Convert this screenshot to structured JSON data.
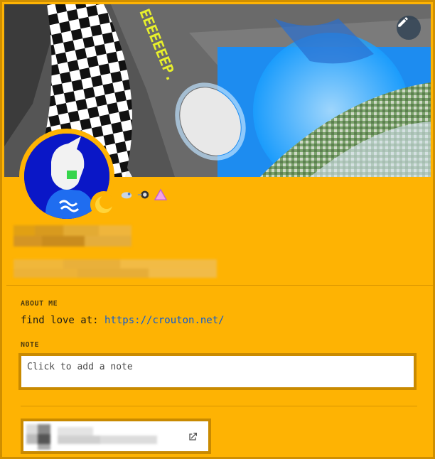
{
  "banner": {
    "graffiti_text": "EEEEEEEP.",
    "edit_button_icon": "pencil-icon"
  },
  "profile": {
    "status_icon": "crescent-moon-icon",
    "badges": [
      "dolphin-badge-icon",
      "rocket-badge-icon",
      "triangle-badge-icon"
    ]
  },
  "about": {
    "heading": "ABOUT ME",
    "text_prefix": "find love at: ",
    "link": "https://crouton.net/"
  },
  "note": {
    "heading": "NOTE",
    "placeholder": "Click to add a note"
  },
  "connection": {
    "open_icon": "external-link-icon"
  },
  "colors": {
    "accent": "#feb303",
    "border": "#c98a00",
    "link": "#0b5bd6",
    "avatar_bg": "#0a17c7"
  }
}
